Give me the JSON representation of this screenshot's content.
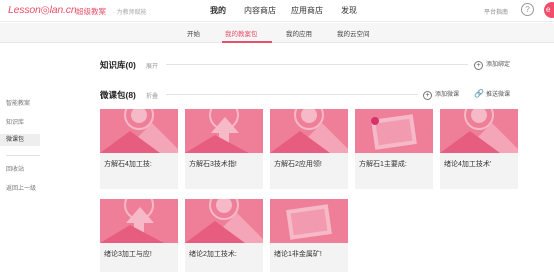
{
  "header": {
    "logo_text": "Lesson",
    "logo_text_2": "lan.cn",
    "brand": "超级教案",
    "slogan": "· 为教师赋能",
    "nav": [
      "我的",
      "内容商店",
      "应用商店",
      "发现"
    ],
    "help": "平台指南",
    "help_icon": "?",
    "avatar_text": "e"
  },
  "subtabs": [
    "开始",
    "我的教案包",
    "我的应用",
    "我的云空间"
  ],
  "sidebar": {
    "items": [
      "智能教案",
      "知识库",
      "微课包"
    ],
    "items2": [
      "回收站",
      "返回上一级"
    ]
  },
  "knowledge": {
    "title": "知识库(0)",
    "toggle": "展开",
    "action": "添加绑定"
  },
  "micro": {
    "title": "微课包(8)",
    "toggle": "折叠",
    "action_add": "添加微课",
    "action_push": "推送微课"
  },
  "icons": {
    "plus": "+",
    "share": "🔗"
  },
  "cards": [
    {
      "caption": "方解石4加工技:"
    },
    {
      "caption": "方解石3技术指!"
    },
    {
      "caption": "方解石2应用领!"
    },
    {
      "caption": "方解石1主要成:"
    },
    {
      "caption": "绪论4加工技术'"
    },
    {
      "caption": "绪论3加工与应!"
    },
    {
      "caption": "绪论2加工技术:"
    },
    {
      "caption": "绪论1非金属矿!"
    }
  ],
  "colors": {
    "accent": "#e8506a",
    "thumb_bg": "#ef7f98",
    "thumb_shape": "#f6b9c7",
    "thumb_dot": "#d6336c"
  }
}
